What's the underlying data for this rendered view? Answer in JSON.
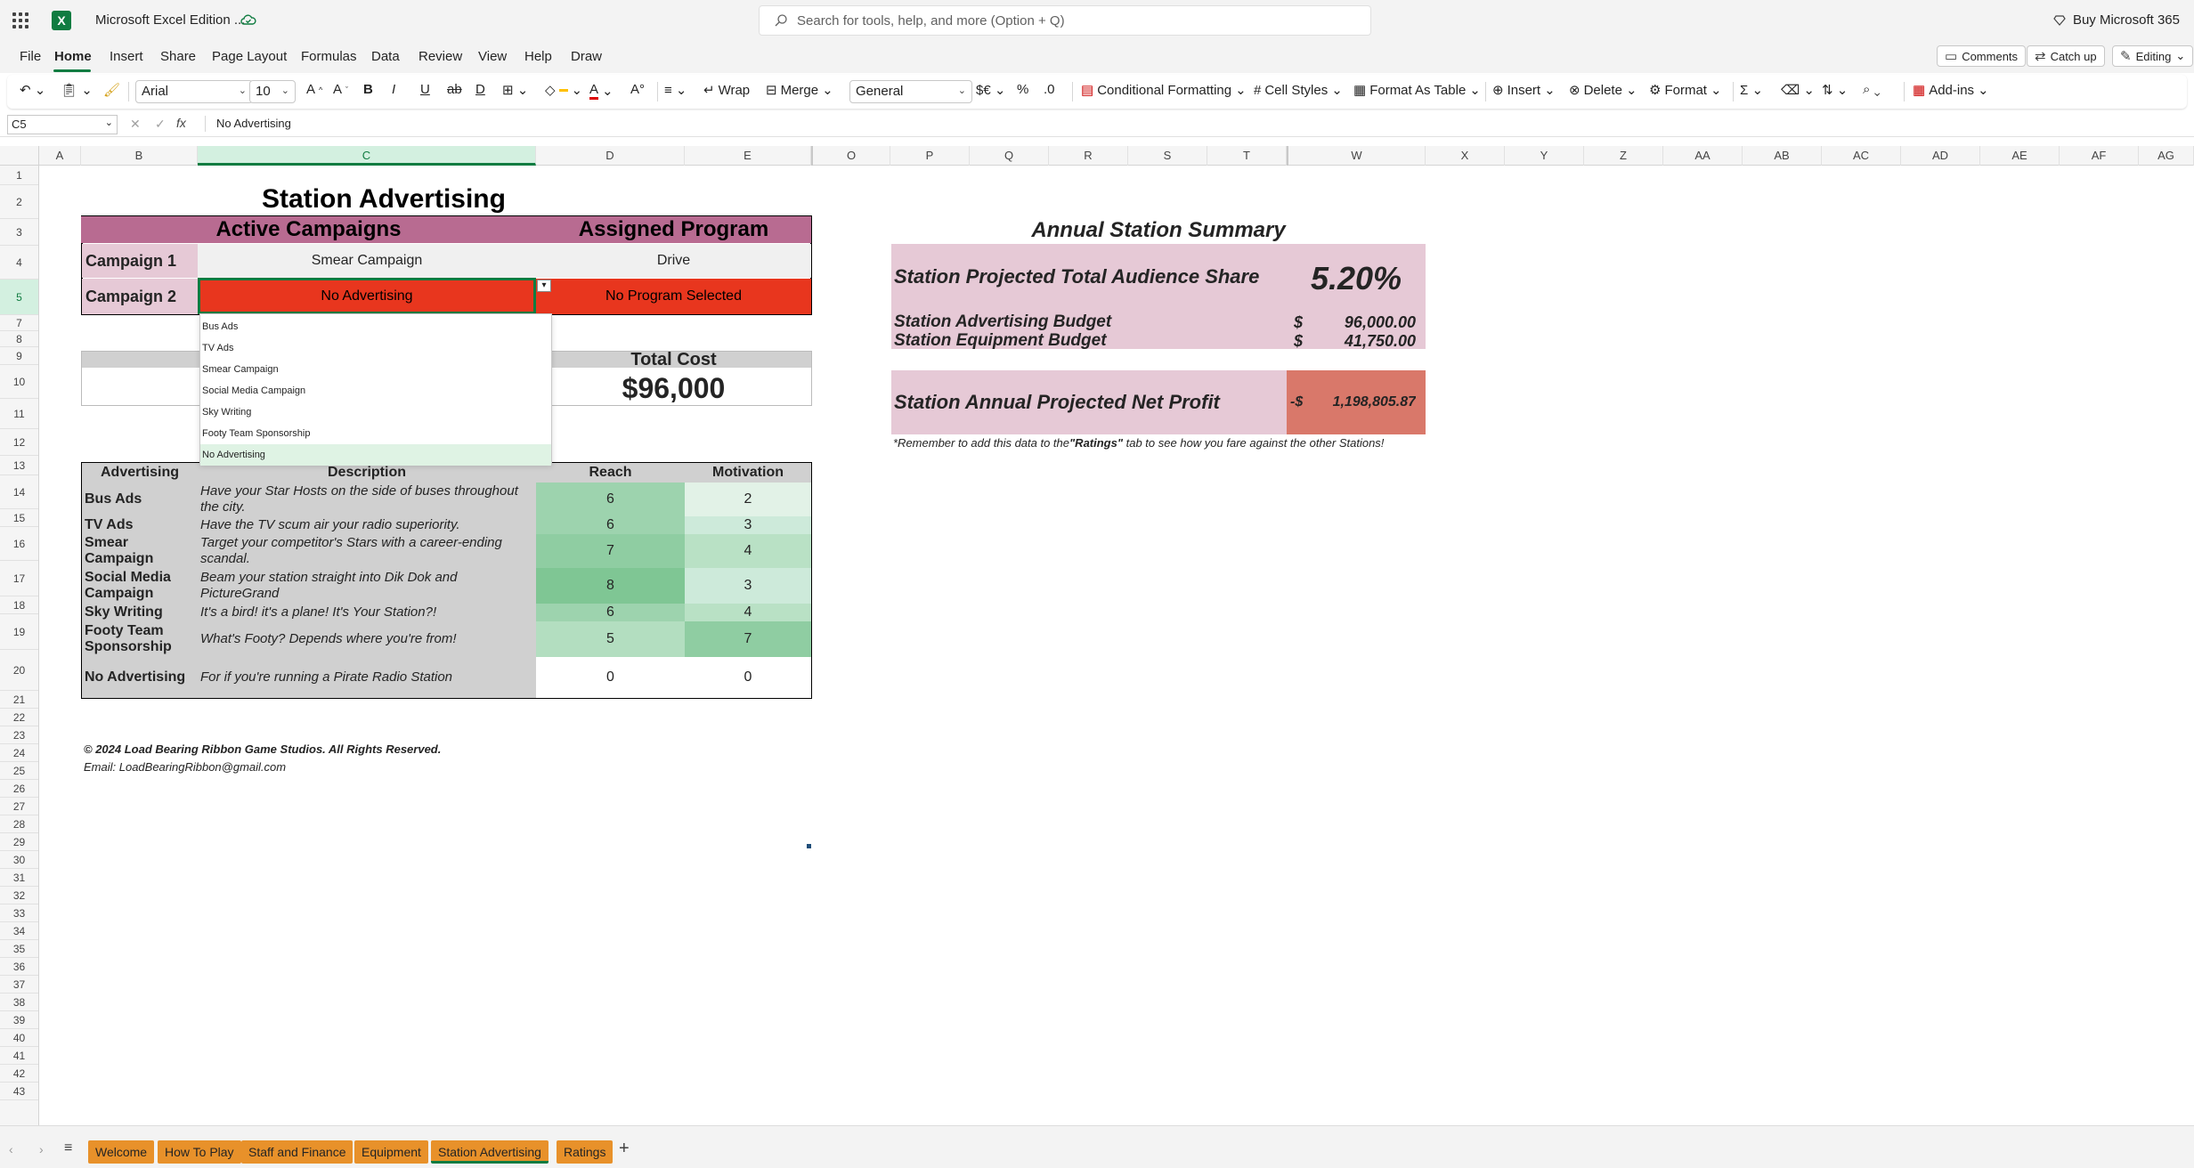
{
  "app": {
    "title": "Microsoft Excel Edition ...",
    "search_placeholder": "Search for tools, help, and more (Option + Q)",
    "buy": "Buy Microsoft 365"
  },
  "menu": [
    "File",
    "Home",
    "Insert",
    "Share",
    "Page Layout",
    "Formulas",
    "Data",
    "Review",
    "View",
    "Help",
    "Draw"
  ],
  "top_buttons": {
    "comments": "Comments",
    "catchup": "Catch up",
    "editing": "Editing"
  },
  "ribbon": {
    "font": "Arial",
    "size": "10",
    "wrap": "Wrap",
    "merge": "Merge",
    "number_format": "General",
    "conditional": "Conditional Formatting",
    "cell_styles": "Cell Styles",
    "format_table": "Format As Table",
    "insert": "Insert",
    "delete": "Delete",
    "format": "Format",
    "addins": "Add-ins"
  },
  "formula_bar": {
    "name_box": "C5",
    "formula": "No Advertising"
  },
  "columns": [
    "A",
    "B",
    "C",
    "D",
    "E",
    "O",
    "P",
    "Q",
    "R",
    "S",
    "T",
    "W",
    "X",
    "Y",
    "Z",
    "AA",
    "AB",
    "AC",
    "AD",
    "AE",
    "AF",
    "AG"
  ],
  "rows": [
    "1",
    "2",
    "3",
    "4",
    "5",
    "7",
    "8",
    "9",
    "10",
    "11",
    "12",
    "13",
    "14",
    "15",
    "16",
    "17",
    "18",
    "19",
    "20",
    "21",
    "22",
    "23",
    "24",
    "25",
    "26",
    "27",
    "28",
    "29",
    "30",
    "31",
    "32",
    "33",
    "34",
    "35",
    "36",
    "37",
    "38",
    "39",
    "40",
    "41",
    "42",
    "43"
  ],
  "sheet": {
    "title": "Station Advertising",
    "active_campaigns": "Active Campaigns",
    "assigned_program": "Assigned Program",
    "campaign1": {
      "label": "Campaign 1",
      "value": "Smear Campaign",
      "program": "Drive"
    },
    "campaign2": {
      "label": "Campaign 2",
      "value": "No Advertising",
      "program": "No Program Selected"
    },
    "total_cost_label": "Total Cost",
    "total_cost": "$96,000",
    "table_headers": [
      "Advertising",
      "Description",
      "Reach",
      "Motivation"
    ],
    "ads": [
      {
        "name": "Bus Ads",
        "desc": "Have your Star Hosts on the side of buses throughout the city.",
        "reach": "6",
        "motivation": "2"
      },
      {
        "name": "TV Ads",
        "desc": "Have the TV scum air your radio superiority.",
        "reach": "6",
        "motivation": "3"
      },
      {
        "name": "Smear Campaign",
        "desc": "Target your competitor's Stars with a career-ending scandal.",
        "reach": "7",
        "motivation": "4"
      },
      {
        "name": "Social Media Campaign",
        "desc": " Beam your station straight into Dik Dok and PictureGrand",
        "reach": "8",
        "motivation": "3"
      },
      {
        "name": "Sky Writing",
        "desc": "It's a bird! it's a plane! It's Your Station?!",
        "reach": "6",
        "motivation": "4"
      },
      {
        "name": "Footy Team Sponsorship",
        "desc": "What's Footy? Depends where you're from!",
        "reach": "5",
        "motivation": "7"
      },
      {
        "name": "No Advertising",
        "desc": "For if you're running a Pirate Radio Station",
        "reach": "0",
        "motivation": "0"
      }
    ],
    "copyright": "© 2024 Load Bearing Ribbon Game Studios. All Rights Reserved.",
    "email": "Email: LoadBearingRibbon@gmail.com",
    "dropdown": [
      "Bus Ads",
      "TV Ads",
      "Smear Campaign",
      "Social Media Campaign",
      "Sky Writing",
      "Footy Team Sponsorship",
      "No Advertising"
    ]
  },
  "summary": {
    "title": "Annual Station Summary",
    "share_label": "Station Projected Total Audience Share",
    "share_value": "5.20%",
    "adv_budget_label": "Station Advertising Budget",
    "adv_budget_cur": "$",
    "adv_budget": "96,000.00",
    "equip_budget_label": "Station Equipment Budget",
    "equip_budget_cur": "$",
    "equip_budget": "41,750.00",
    "profit_label": "Station Annual Projected Net Profit",
    "profit_cur": "-$",
    "profit": "1,198,805.87",
    "note_pre": "*Remember to add this data to the ",
    "note_bold": "\"Ratings\"",
    "note_post": " tab to see how you fare against the other Stations!"
  },
  "tabs": [
    "Welcome",
    "How To Play",
    "Staff and Finance",
    "Equipment",
    "Station Advertising",
    "Ratings"
  ],
  "colors": {
    "campaign_header": "#b86b91",
    "campaign_label": "#e6c9d6",
    "alert_red": "#e8361e",
    "profit_red": "#d9786a",
    "tab_orange": "#e8912a",
    "excel_green": "#107c41"
  }
}
